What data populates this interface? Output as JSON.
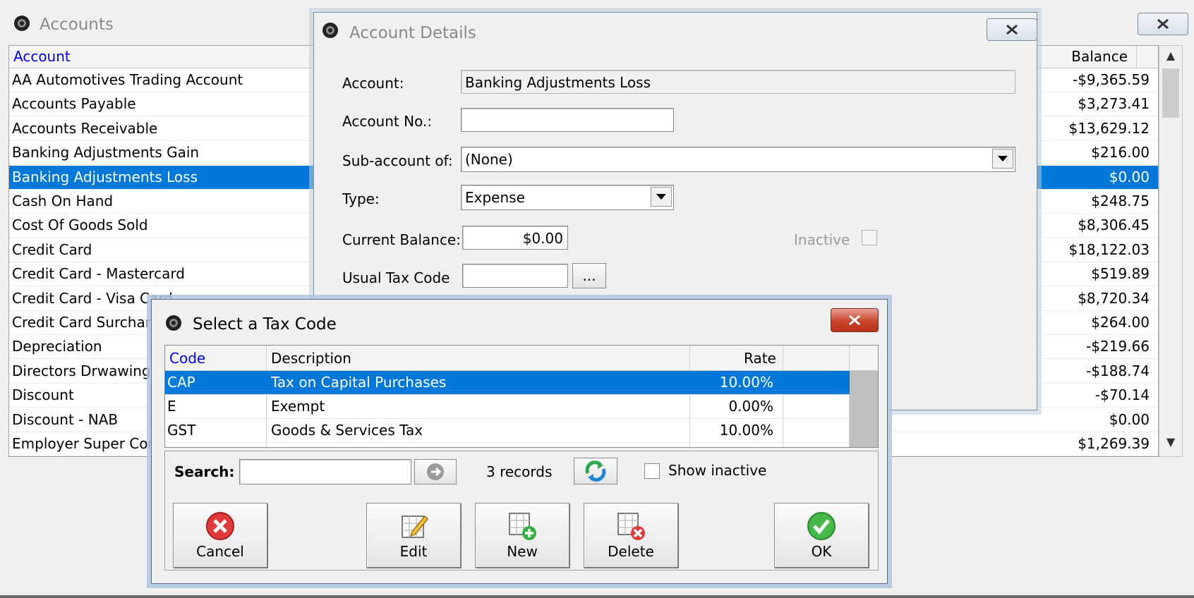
{
  "accounts_window": {
    "title": "Accounts",
    "columns": {
      "account": "Account",
      "balance": "Balance"
    },
    "selected_index": 4,
    "rows": [
      {
        "name": "AA Automotives Trading Account",
        "balance": "-$9,365.59"
      },
      {
        "name": "Accounts Payable",
        "balance": "$3,273.41"
      },
      {
        "name": "Accounts Receivable",
        "balance": "$13,629.12"
      },
      {
        "name": "Banking Adjustments Gain",
        "balance": "$216.00"
      },
      {
        "name": "Banking Adjustments Loss",
        "balance": "$0.00"
      },
      {
        "name": "Cash On Hand",
        "balance": "$248.75"
      },
      {
        "name": "Cost Of Goods Sold",
        "balance": "$8,306.45"
      },
      {
        "name": "Credit Card",
        "balance": "$18,122.03"
      },
      {
        "name": "Credit Card - Mastercard",
        "balance": "$519.89"
      },
      {
        "name": "Credit Card - Visa Card",
        "balance": "$8,720.34"
      },
      {
        "name": "Credit Card Surcharg",
        "balance": "$264.00"
      },
      {
        "name": "Depreciation",
        "balance": "-$219.66"
      },
      {
        "name": "Directors Drwawings",
        "balance": "-$188.74"
      },
      {
        "name": "Discount",
        "balance": "-$70.14"
      },
      {
        "name": "Discount - NAB",
        "balance": "$0.00"
      },
      {
        "name": "Employer Super Cont",
        "balance": "$1,269.39"
      }
    ]
  },
  "account_details": {
    "title": "Account Details",
    "account_label": "Account:",
    "account_value": "Banking Adjustments Loss",
    "account_no_label": "Account No.:",
    "account_no_value": "",
    "subaccount_label": "Sub-account of:",
    "subaccount_value": "(None)",
    "type_label": "Type:",
    "type_value": "Expense",
    "current_balance_label": "Current Balance:",
    "current_balance_value": "$0.00",
    "inactive_label": "Inactive",
    "usual_tax_code_label": "Usual Tax Code",
    "usual_tax_code_value": "",
    "browse_label": "..."
  },
  "tax_dialog": {
    "title": "Select a Tax Code",
    "columns": {
      "code": "Code",
      "description": "Description",
      "rate": "Rate"
    },
    "selected_index": 0,
    "rows": [
      {
        "code": "CAP",
        "description": "Tax on Capital Purchases",
        "rate": "10.00%"
      },
      {
        "code": "E",
        "description": "Exempt",
        "rate": "0.00%"
      },
      {
        "code": "GST",
        "description": "Goods & Services Tax",
        "rate": "10.00%"
      }
    ],
    "search_label": "Search:",
    "search_value": "",
    "record_count": "3 records",
    "show_inactive_label": "Show inactive",
    "buttons": {
      "cancel": "Cancel",
      "edit": "Edit",
      "new": "New",
      "delete": "Delete",
      "ok": "OK"
    }
  },
  "icons": {
    "window": "app-logo-icon",
    "close": "close-icon",
    "search_go": "arrow-right-icon",
    "refresh": "refresh-icon",
    "cancel": "cancel-icon",
    "edit": "edit-icon",
    "new": "new-icon",
    "delete": "delete-icon",
    "ok": "ok-icon"
  },
  "colors": {
    "selection": "#0078d7",
    "header_link": "#0000e0",
    "close_red": "#c9452e"
  }
}
